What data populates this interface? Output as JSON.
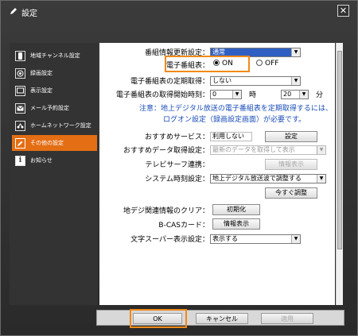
{
  "window": {
    "title": "設定",
    "close_label": "✕"
  },
  "sidebar": {
    "items": [
      {
        "label": "地域チャンネル設定",
        "icon": "remote-icon"
      },
      {
        "label": "録画設定",
        "icon": "record-icon"
      },
      {
        "label": "表示設定",
        "icon": "display-icon"
      },
      {
        "label": "メール予約設定",
        "icon": "mail-icon"
      },
      {
        "label": "ホームネットワーク設定",
        "icon": "network-icon"
      },
      {
        "label": "その他の設定",
        "icon": "pencil-icon",
        "active": true
      },
      {
        "label": "お知らせ",
        "icon": "info-icon"
      }
    ]
  },
  "settings": {
    "program_update": {
      "label": "番組情報更新設定：",
      "value": "通常"
    },
    "epg": {
      "label": "電子番組表：",
      "on": "ON",
      "off": "OFF",
      "selected": "ON"
    },
    "epg_periodic": {
      "label": "電子番組表の定期取得：",
      "value": "しない"
    },
    "epg_start_time": {
      "label": "電子番組表の取得開始時刻：",
      "hour": "0",
      "hour_unit": "時",
      "minute": "20",
      "minute_unit": "分"
    },
    "note_line1": "注意：地上デジタル放送の電子番組表を定期取得するには、",
    "note_line2": "ログオン設定（録画設定画面）が必要です。",
    "recommend_service": {
      "label": "おすすめサービス：",
      "value": "利用しない",
      "button": "設定"
    },
    "recommend_data": {
      "label": "おすすめデータ取得設定：",
      "value": "最新のデータを取得して表示"
    },
    "telesurf": {
      "label": "テレビサーフ連携：",
      "button": "情報表示"
    },
    "system_clock": {
      "label": "システム時刻設定：",
      "value": "地上デジタル放送波で調整する",
      "button": "今すぐ調整"
    },
    "clear_digital": {
      "label": "地デジ関連情報のクリア：",
      "button": "初期化"
    },
    "bcas": {
      "label": "B-CASカード：",
      "button": "情報表示"
    },
    "text_super": {
      "label": "文字スーパー表示設定：",
      "value": "表示する"
    }
  },
  "footer": {
    "ok": "OK",
    "cancel": "キャンセル",
    "apply": "適用"
  },
  "colors": {
    "accent": "#f08a18",
    "active_nav": "#e46e14",
    "note": "#1a4db8",
    "highlight": "#2f5fc2"
  }
}
